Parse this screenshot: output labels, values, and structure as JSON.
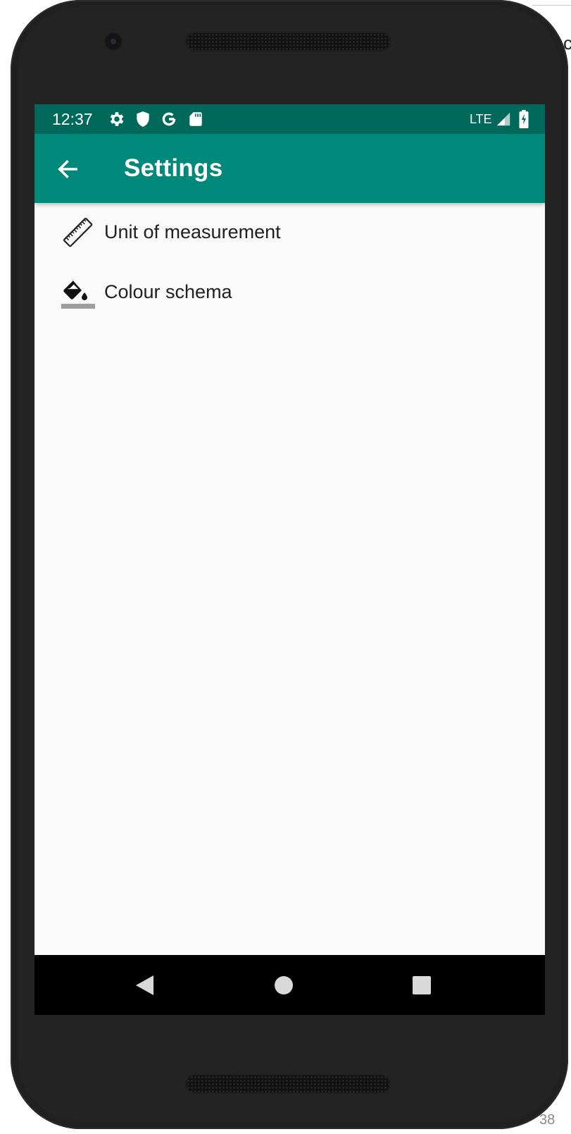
{
  "status_bar": {
    "time": "12:37",
    "network": "LTE",
    "icons": [
      "settings-icon",
      "shield-icon",
      "google-icon",
      "sd-card-icon",
      "signal-icon",
      "battery-charging-icon"
    ]
  },
  "app_bar": {
    "title": "Settings",
    "back_icon": "arrow-back-icon",
    "color": "#00897b",
    "status_color": "#00695c"
  },
  "settings": {
    "items": [
      {
        "label": "Unit of measurement",
        "icon": "ruler-icon"
      },
      {
        "label": "Colour schema",
        "icon": "paint-bucket-icon"
      }
    ]
  },
  "nav_bar": {
    "icons": [
      "back-triangle-icon",
      "home-circle-icon",
      "recents-square-icon"
    ]
  },
  "document": {
    "page_number": "38",
    "peek_char": "c"
  }
}
